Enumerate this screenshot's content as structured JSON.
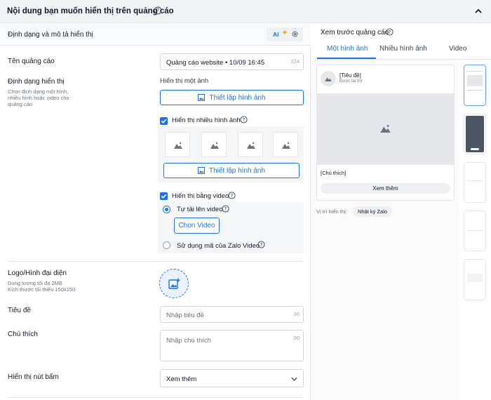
{
  "header": {
    "title": "Nội dung bạn muốn hiển thị trên quảng cáo"
  },
  "section": {
    "title": "Định dạng và mô tả hiển thị",
    "ai_label": "AI"
  },
  "ad_name": {
    "label": "Tên quảng cáo",
    "value": "Quảng cáo website • 10/09 16:45",
    "count": "224"
  },
  "display_format": {
    "label": "Định dạng hiển thị",
    "description": "Chọn định dạng một hình, nhiều hình hoặc video cho quảng cáo",
    "single_label": "Hiển thị một ảnh",
    "setup_button": "Thiết lập hình ảnh",
    "multi_label": "Hiển thị nhiều hình ảnh",
    "multi_setup_button": "Thiết lập hình ảnh",
    "video_label": "Hiển thị bằng video",
    "upload_option": "Tự tải lên video",
    "choose_video_button": "Chọn Video",
    "zalo_option": "Sử dụng mã của Zalo Video"
  },
  "logo": {
    "label": "Logo/Hình đại diện",
    "desc1": "Dung lượng tối đa 2MB",
    "desc2": "Kích thước tối thiểu 150x150"
  },
  "title_field": {
    "label": "Tiêu đề",
    "placeholder": "Nhập tiêu đề",
    "count": "30"
  },
  "caption_field": {
    "label": "Chú thích",
    "placeholder": "Nhập chú thích",
    "count": "90"
  },
  "button_field": {
    "label": "Hiển thị nút bấm",
    "value": "Xem thêm"
  },
  "preview": {
    "title": "Xem trước quảng cáo",
    "tabs": [
      "Một hình ảnh",
      "Nhiều hình ảnh",
      "Video"
    ],
    "card_title": "[Tiêu đề]",
    "card_sponsor": "Được tài trợ",
    "card_caption": "[Chú thích]",
    "card_button": "Xem thêm",
    "position_label": "Vị trí hiển thị:",
    "position_value": "Nhật ký Zalo"
  },
  "colors": {
    "accent": "#1a73e8",
    "border": "#e5e7eb",
    "muted": "#6b7280"
  }
}
